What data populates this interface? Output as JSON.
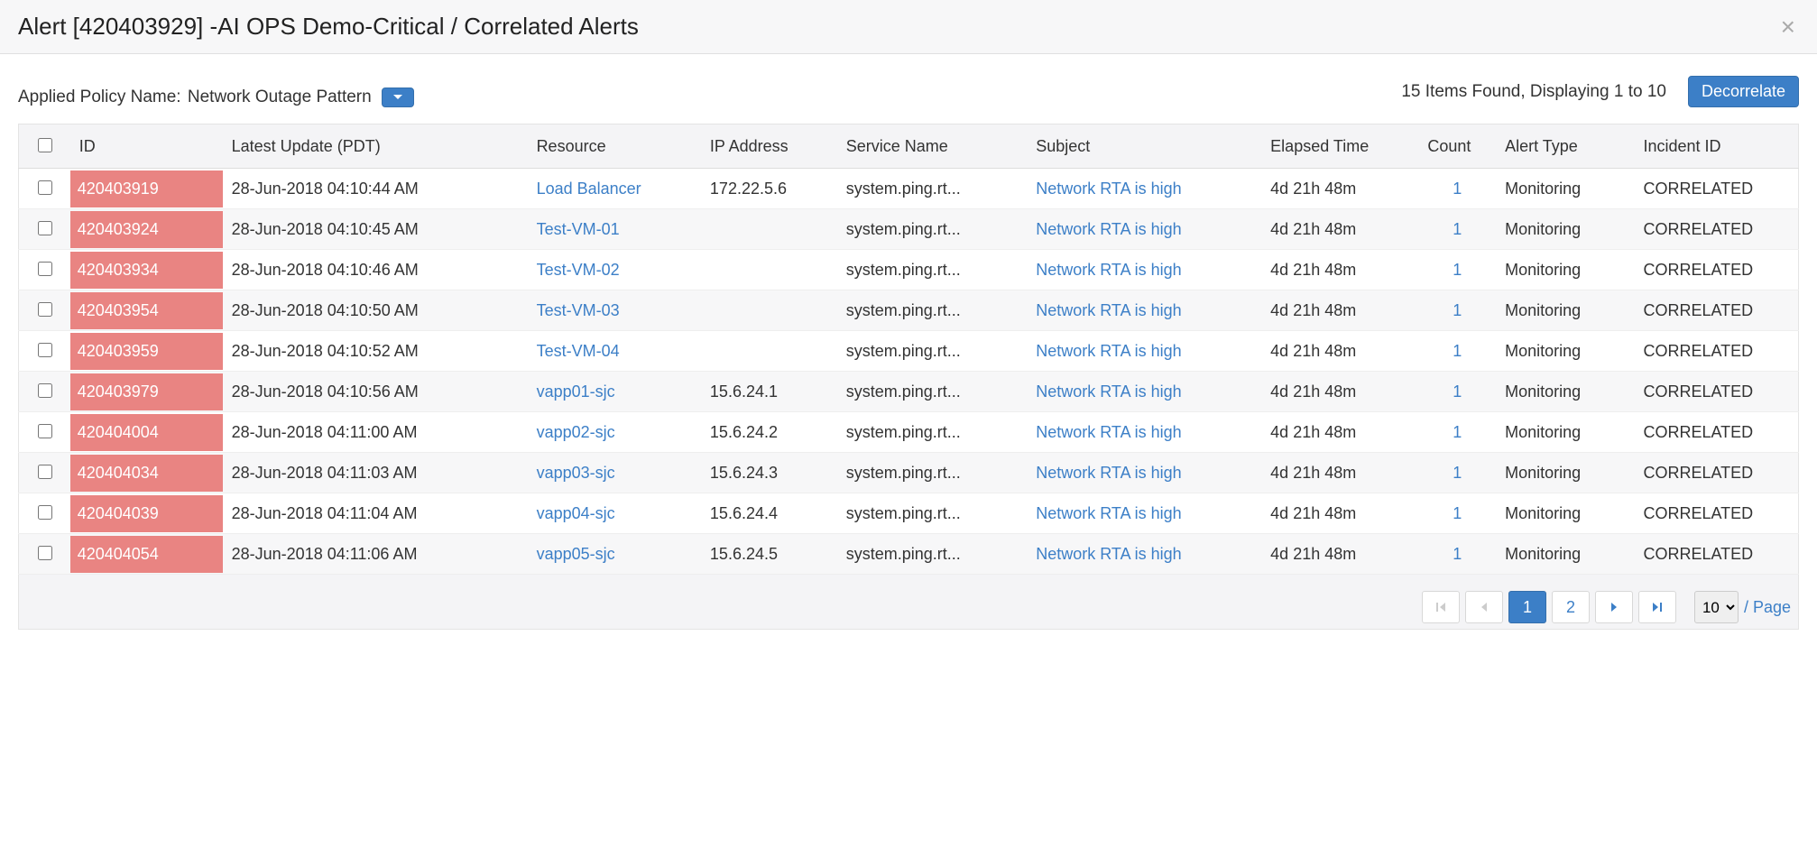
{
  "header": {
    "title": "Alert [420403929] -AI OPS Demo-Critical / Correlated Alerts"
  },
  "toolbar": {
    "policy_label": "Applied Policy Name:",
    "policy_value": "Network Outage Pattern",
    "items_status": "15 Items Found, Displaying 1 to 10",
    "decorrelate_label": "Decorrelate"
  },
  "columns": {
    "id": "ID",
    "latest": "Latest Update (PDT)",
    "resource": "Resource",
    "ip": "IP Address",
    "service": "Service Name",
    "subject": "Subject",
    "elapsed": "Elapsed Time",
    "count": "Count",
    "type": "Alert Type",
    "incident": "Incident ID"
  },
  "rows": [
    {
      "id": "420403919",
      "latest": "28-Jun-2018 04:10:44 AM",
      "resource": "Load Balancer",
      "ip": "172.22.5.6",
      "service": "system.ping.rt...",
      "subject": "Network RTA is high",
      "elapsed": "4d 21h 48m",
      "count": "1",
      "type": "Monitoring",
      "incident": "CORRELATED"
    },
    {
      "id": "420403924",
      "latest": "28-Jun-2018 04:10:45 AM",
      "resource": "Test-VM-01",
      "ip": "",
      "service": "system.ping.rt...",
      "subject": "Network RTA is high",
      "elapsed": "4d 21h 48m",
      "count": "1",
      "type": "Monitoring",
      "incident": "CORRELATED"
    },
    {
      "id": "420403934",
      "latest": "28-Jun-2018 04:10:46 AM",
      "resource": "Test-VM-02",
      "ip": "",
      "service": "system.ping.rt...",
      "subject": "Network RTA is high",
      "elapsed": "4d 21h 48m",
      "count": "1",
      "type": "Monitoring",
      "incident": "CORRELATED"
    },
    {
      "id": "420403954",
      "latest": "28-Jun-2018 04:10:50 AM",
      "resource": "Test-VM-03",
      "ip": "",
      "service": "system.ping.rt...",
      "subject": "Network RTA is high",
      "elapsed": "4d 21h 48m",
      "count": "1",
      "type": "Monitoring",
      "incident": "CORRELATED"
    },
    {
      "id": "420403959",
      "latest": "28-Jun-2018 04:10:52 AM",
      "resource": "Test-VM-04",
      "ip": "",
      "service": "system.ping.rt...",
      "subject": "Network RTA is high",
      "elapsed": "4d 21h 48m",
      "count": "1",
      "type": "Monitoring",
      "incident": "CORRELATED"
    },
    {
      "id": "420403979",
      "latest": "28-Jun-2018 04:10:56 AM",
      "resource": "vapp01-sjc",
      "ip": "15.6.24.1",
      "service": "system.ping.rt...",
      "subject": "Network RTA is high",
      "elapsed": "4d 21h 48m",
      "count": "1",
      "type": "Monitoring",
      "incident": "CORRELATED"
    },
    {
      "id": "420404004",
      "latest": "28-Jun-2018 04:11:00 AM",
      "resource": "vapp02-sjc",
      "ip": "15.6.24.2",
      "service": "system.ping.rt...",
      "subject": "Network RTA is high",
      "elapsed": "4d 21h 48m",
      "count": "1",
      "type": "Monitoring",
      "incident": "CORRELATED"
    },
    {
      "id": "420404034",
      "latest": "28-Jun-2018 04:11:03 AM",
      "resource": "vapp03-sjc",
      "ip": "15.6.24.3",
      "service": "system.ping.rt...",
      "subject": "Network RTA is high",
      "elapsed": "4d 21h 48m",
      "count": "1",
      "type": "Monitoring",
      "incident": "CORRELATED"
    },
    {
      "id": "420404039",
      "latest": "28-Jun-2018 04:11:04 AM",
      "resource": "vapp04-sjc",
      "ip": "15.6.24.4",
      "service": "system.ping.rt...",
      "subject": "Network RTA is high",
      "elapsed": "4d 21h 48m",
      "count": "1",
      "type": "Monitoring",
      "incident": "CORRELATED"
    },
    {
      "id": "420404054",
      "latest": "28-Jun-2018 04:11:06 AM",
      "resource": "vapp05-sjc",
      "ip": "15.6.24.5",
      "service": "system.ping.rt...",
      "subject": "Network RTA is high",
      "elapsed": "4d 21h 48m",
      "count": "1",
      "type": "Monitoring",
      "incident": "CORRELATED"
    }
  ],
  "pagination": {
    "pages": [
      "1",
      "2"
    ],
    "active": "1",
    "page_size": "10",
    "page_size_suffix": "/ Page"
  }
}
